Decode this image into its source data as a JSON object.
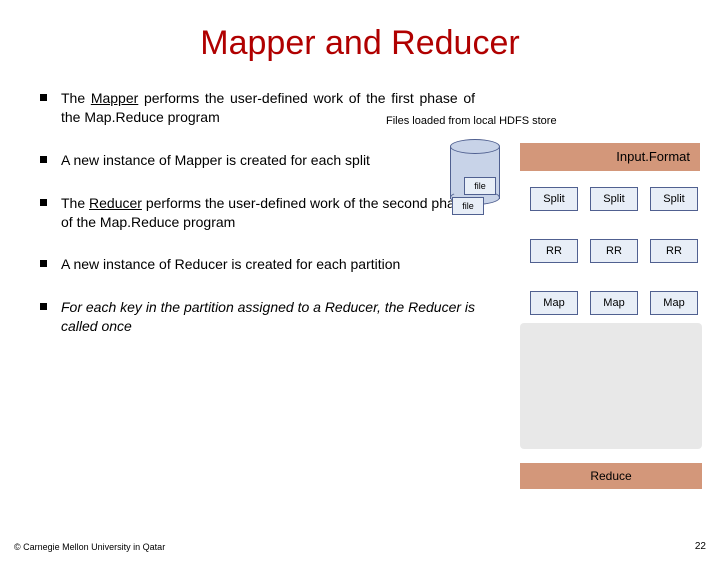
{
  "title": "Mapper and Reducer",
  "bullets": {
    "b1_pre": "The ",
    "b1_mapper": "Mapper",
    "b1_post": " performs the user-defined work of the first phase of the Map.Reduce program",
    "b2": "A new instance of Mapper is created for each split",
    "b3_pre": "The ",
    "b3_reducer": "Reducer",
    "b3_post": " performs the user-defined work of the second phase of the Map.Reduce program",
    "b4": "A new instance of Reducer is created for each partition",
    "b5": "For each key in the partition assigned to a Reducer, the Reducer is called once"
  },
  "diagram": {
    "hdfs_note": "Files loaded from local HDFS store",
    "file1": "file",
    "file2": "file",
    "inputformat": "Input.Format",
    "splits": [
      "Split",
      "Split",
      "Split"
    ],
    "rrs": [
      "RR",
      "RR",
      "RR"
    ],
    "maps": [
      "Map",
      "Map",
      "Map"
    ],
    "reduce": "Reduce"
  },
  "footer": "© Carnegie Mellon University in Qatar",
  "pagenum": "22"
}
